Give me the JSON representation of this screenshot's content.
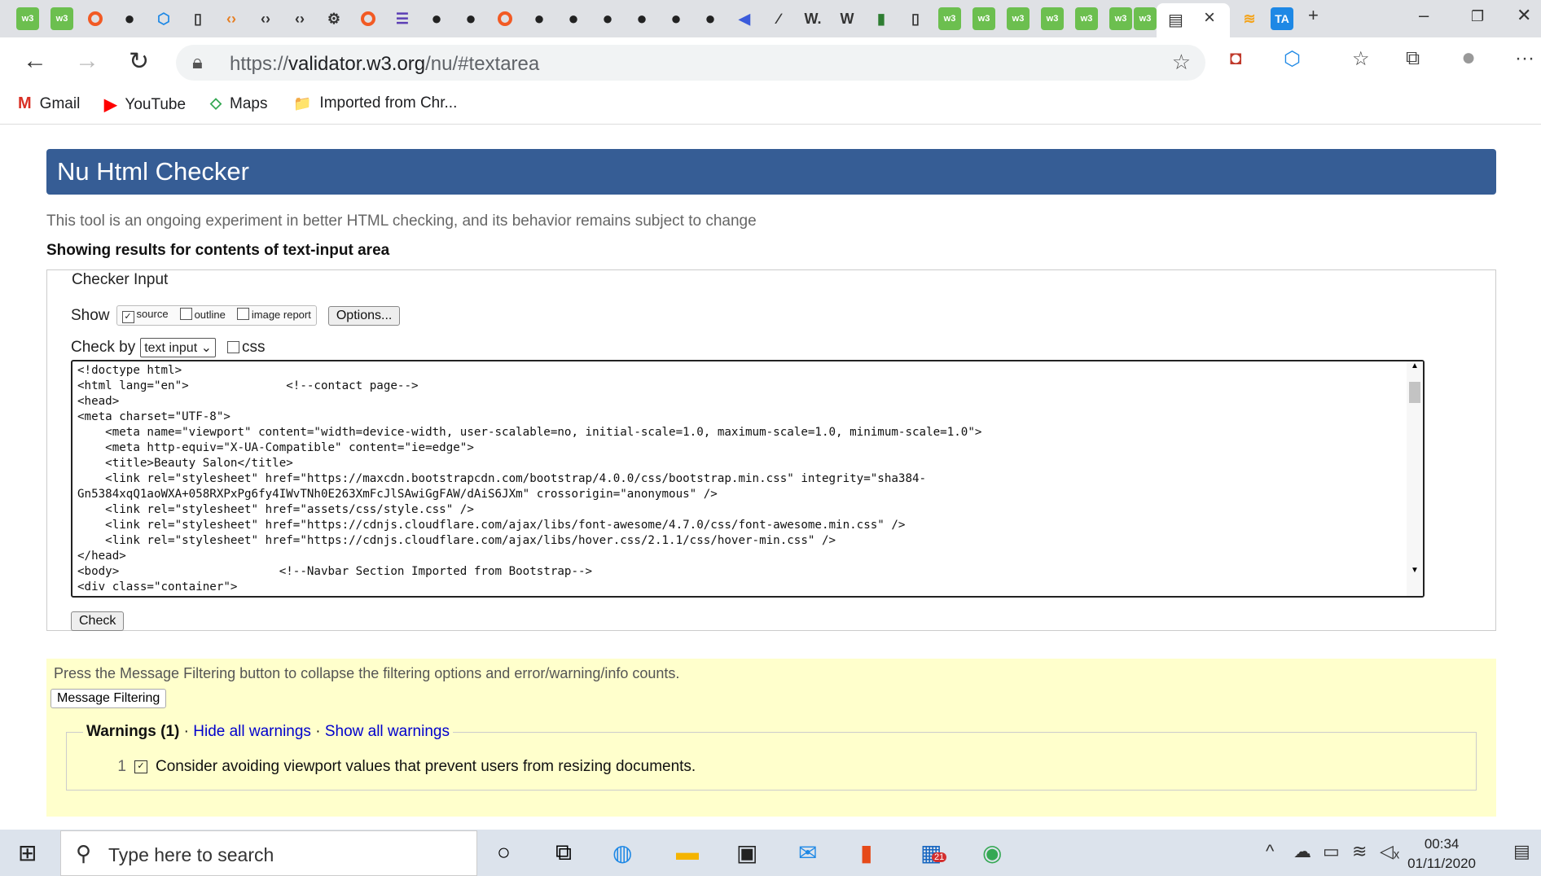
{
  "browser": {
    "url_prefix": "https://",
    "url_host": "validator.w3.org",
    "url_path": "/nu/#textarea",
    "tab_w3_label": "w3",
    "tab_ta_label": "TA",
    "bookmarks": [
      {
        "icon": "M",
        "label": "Gmail"
      },
      {
        "icon": "▶",
        "label": "YouTube"
      },
      {
        "icon": "⬦",
        "label": "Maps"
      },
      {
        "icon": "📁",
        "label": "Imported from Chr..."
      }
    ]
  },
  "page": {
    "title": "Nu Html Checker",
    "intro": "This tool is an ongoing experiment in better HTML checking, and its behavior remains subject to change",
    "showing": "Showing results for contents of text-input area",
    "checker_input": {
      "legend": "Checker Input",
      "show_label": "Show",
      "options": [
        {
          "label": "source",
          "checked": true
        },
        {
          "label": "outline",
          "checked": false
        },
        {
          "label": "image report",
          "checked": false
        }
      ],
      "options_button": "Options...",
      "check_by_label": "Check by",
      "check_by_value": "text input",
      "css_label": "css",
      "code": "<!doctype html>\n<html lang=\"en\">              <!--contact page-->\n<head>\n<meta charset=\"UTF-8\">\n    <meta name=\"viewport\" content=\"width=device-width, user-scalable=no, initial-scale=1.0, maximum-scale=1.0, minimum-scale=1.0\">\n    <meta http-equiv=\"X-UA-Compatible\" content=\"ie=edge\">\n    <title>Beauty Salon</title>\n    <link rel=\"stylesheet\" href=\"https://maxcdn.bootstrapcdn.com/bootstrap/4.0.0/css/bootstrap.min.css\" integrity=\"sha384-\nGn5384xqQ1aoWXA+058RXPxPg6fy4IWvTNh0E263XmFcJlSAwiGgFAW/dAiS6JXm\" crossorigin=\"anonymous\" />\n    <link rel=\"stylesheet\" href=\"assets/css/style.css\" />\n    <link rel=\"stylesheet\" href=\"https://cdnjs.cloudflare.com/ajax/libs/font-awesome/4.7.0/css/font-awesome.min.css\" />\n    <link rel=\"stylesheet\" href=\"https://cdnjs.cloudflare.com/ajax/libs/hover.css/2.1.1/css/hover-min.css\" />\n</head>\n<body>                       <!--Navbar Section Imported from Bootstrap-->\n<div class=\"container\">",
      "check_button": "Check"
    },
    "filtering": {
      "text": "Press the Message Filtering button to collapse the filtering options and error/warning/info counts.",
      "button": "Message Filtering",
      "warnings_title": "Warnings (1)",
      "separator": "·",
      "hide_all": "Hide all warnings",
      "show_all": "Show all warnings",
      "items": [
        {
          "num": "1",
          "text": "Consider avoiding viewport values that prevent users from resizing documents."
        }
      ]
    }
  },
  "taskbar": {
    "search_placeholder": "Type here to search",
    "time": "00:34",
    "date": "01/11/2020",
    "badge": "21"
  }
}
